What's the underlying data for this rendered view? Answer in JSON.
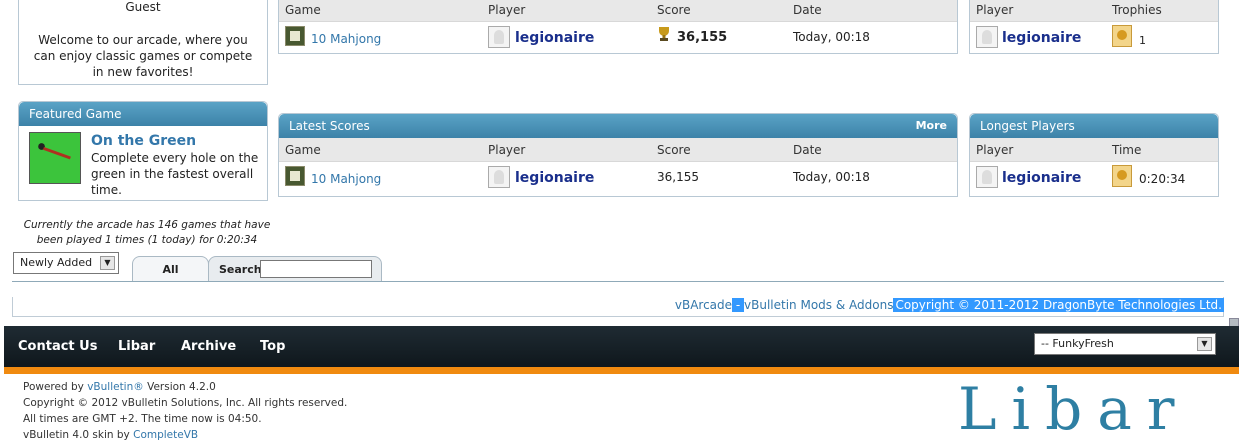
{
  "welcome": {
    "user": "Guest",
    "message": "Welcome to our arcade, where you can enjoy classic games or compete in new favorites!"
  },
  "champions": {
    "headers": [
      "Game",
      "Player",
      "Score",
      "Date"
    ],
    "row": {
      "game": "10 Mahjong",
      "player": "legionaire",
      "score": "36,155",
      "date": "Today, 00:18"
    }
  },
  "top_players": {
    "headers": [
      "Player",
      "Trophies"
    ],
    "row": {
      "player": "legionaire",
      "trophies": "1"
    }
  },
  "featured": {
    "title": "Featured Game",
    "game_name": "On the Green",
    "description": "Complete every hole on the green in the fastest overall time."
  },
  "latest_scores": {
    "title": "Latest Scores",
    "more": "More",
    "headers": [
      "Game",
      "Player",
      "Score",
      "Date"
    ],
    "row": {
      "game": "10 Mahjong",
      "player": "legionaire",
      "score": "36,155",
      "date": "Today, 00:18"
    }
  },
  "longest_players": {
    "title": "Longest Players",
    "headers": [
      "Player",
      "Time"
    ],
    "row": {
      "player": "legionaire",
      "time": "0:20:34"
    }
  },
  "stats_text": "Currently the arcade has 146 games that have been played 1 times (1 today) for 0:20:34",
  "controls": {
    "sort_value": "Newly Added",
    "tab_all": "All",
    "tab_search": "Search",
    "search_value": ""
  },
  "copyright_line": {
    "vbarcade": "vBArcade",
    "separator": " - ",
    "mods": "vBulletin Mods & Addons",
    "copyright": "Copyright © 2011-2012 DragonByte Technologies Ltd."
  },
  "footer_nav": [
    "Contact Us",
    "Libar",
    "Archive",
    "Top"
  ],
  "style_select": "-- FunkyFresh",
  "fine_print": {
    "powered_prefix": "Powered by ",
    "powered_link": "vBulletin®",
    "powered_suffix": " Version 4.2.0",
    "copyright": "Copyright © 2012 vBulletin Solutions, Inc. All rights reserved.",
    "times": "All times are GMT +2. The time now is 04:50.",
    "skin_prefix": "vBulletin 4.0 skin by ",
    "skin_link": "CompleteVB"
  },
  "logo_text": "Libar",
  "colors": {
    "header": "#4a93b8",
    "accent": "#f08a10",
    "footer": "#1a252c",
    "link": "#3377aa"
  }
}
